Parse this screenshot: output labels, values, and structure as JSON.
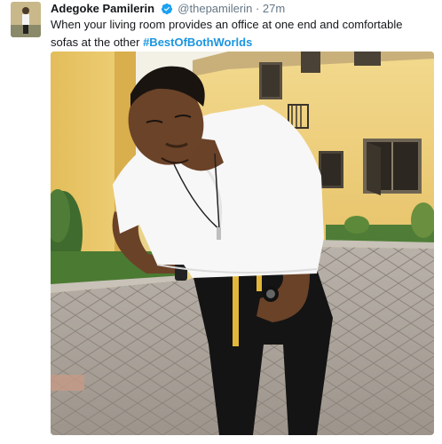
{
  "tweet": {
    "display_name": "Adegoke Pamilerin",
    "handle": "@thepamilerin",
    "separator": "·",
    "timestamp": "27m",
    "verified": true,
    "text_main": "When your living room provides an office at one end and comfortable sofas at the other ",
    "hashtag": "#BestOfBothWorlds"
  },
  "icons": {
    "avatar": "avatar",
    "verified": "verified-badge-icon"
  },
  "colors": {
    "name": "#14171a",
    "meta": "#657786",
    "hashtag": "#1b95e0",
    "verified": "#1da1f2"
  }
}
